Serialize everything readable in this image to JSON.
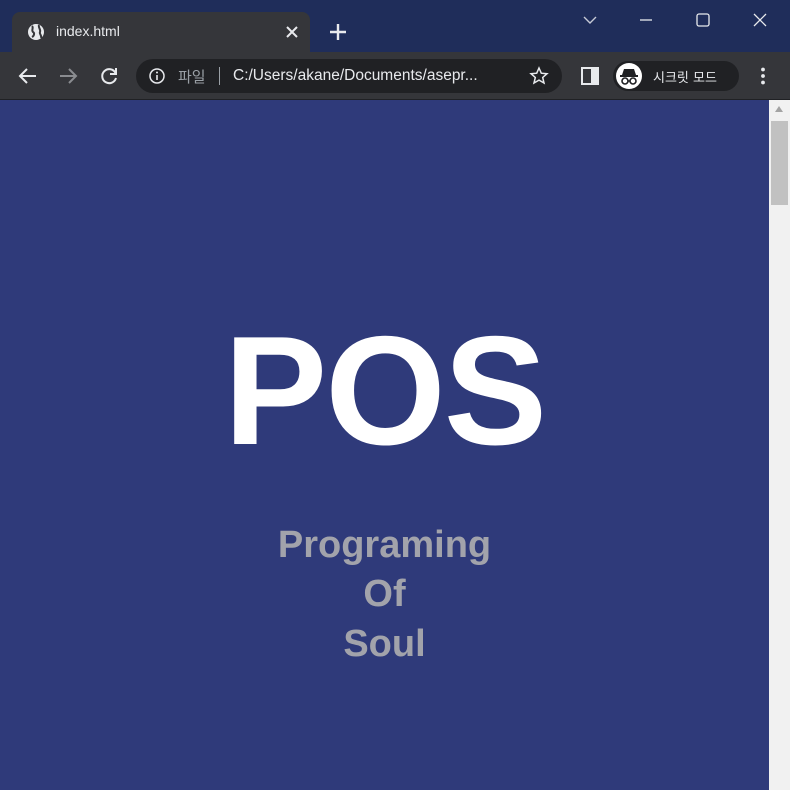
{
  "browser": {
    "tab": {
      "title": "index.html",
      "icon": "globe-icon"
    },
    "omnibox": {
      "scheme_chip": "파일",
      "url": "C:/Users/akane/Documents/asepr..."
    },
    "incognito_label": "시크릿 모드"
  },
  "page": {
    "hero_title": "POS",
    "tagline": [
      "Programing",
      "Of",
      "Soul"
    ]
  },
  "colors": {
    "tabstrip": "#1f2d5a",
    "toolbar": "#35363a",
    "page_background": "#2f3a7a",
    "hero_text": "#ffffff",
    "tagline_text": "#a2a3ab"
  }
}
